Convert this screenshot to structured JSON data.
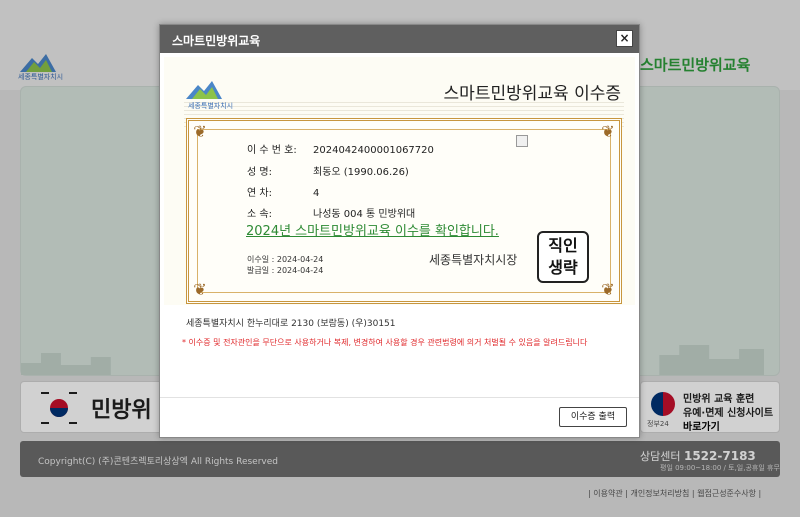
{
  "background": {
    "logo_text": "세종특별자치시",
    "brand": "스마트민방위교육",
    "banner_left": "민방위",
    "banner_right": {
      "emblem_caption": "정부24",
      "line1": "민방위 교육 훈련",
      "line2": "유예·면제 신청사이트",
      "line3": "바로가기"
    },
    "footer": {
      "copyright": "Copyright(C) (주)콘텐츠렉토리상상엑 All Rights Reserved",
      "cs_label": "상담센터",
      "cs_phone": "1522-7183",
      "cs_hours": "평일 09:00~18:00 / 토,일,공휴일 휴무"
    },
    "links": "| 이용약관 | 개인정보처리방침 | 웹접근성준수사항 |"
  },
  "modal": {
    "title": "스마트민방위교육",
    "close": "×",
    "certificate": {
      "logo_text": "세종특별자치시",
      "title": "스마트민방위교육 이수증",
      "fields": [
        {
          "label": "이 수 번 호:",
          "value": "2024042400001067720"
        },
        {
          "label": "성       명:",
          "value": "최동오 (1990.06.26)"
        },
        {
          "label": "연       차:",
          "value": "4"
        },
        {
          "label": "소       속:",
          "value": "나성동 004 통 민방위대"
        }
      ],
      "confirm_text": "2024년 스마트민방위교육 이수를 확인합니다.",
      "completion_date": "이수일 : 2024-04-24",
      "issue_date": "발급일 : 2024-04-24",
      "issuer": "세종특별자치시장",
      "seal_line1": "직인",
      "seal_line2": "생략"
    },
    "address": "세종특별자치시 한누리대로 2130 (보람동) (우)30151",
    "warning": "* 이수증 및 전자관인을 무단으로 사용하거나 복제, 변경하여 사용할 경우 관련법령에 의거 처벌될 수 있음을 알려드립니다",
    "print_button": "이수증 출력"
  },
  "colors": {
    "modal_title_bg": "#5f5f5f",
    "frame_gold": "#c8963e",
    "confirm_green": "#2d8a34",
    "warning_red": "#e0282b"
  }
}
